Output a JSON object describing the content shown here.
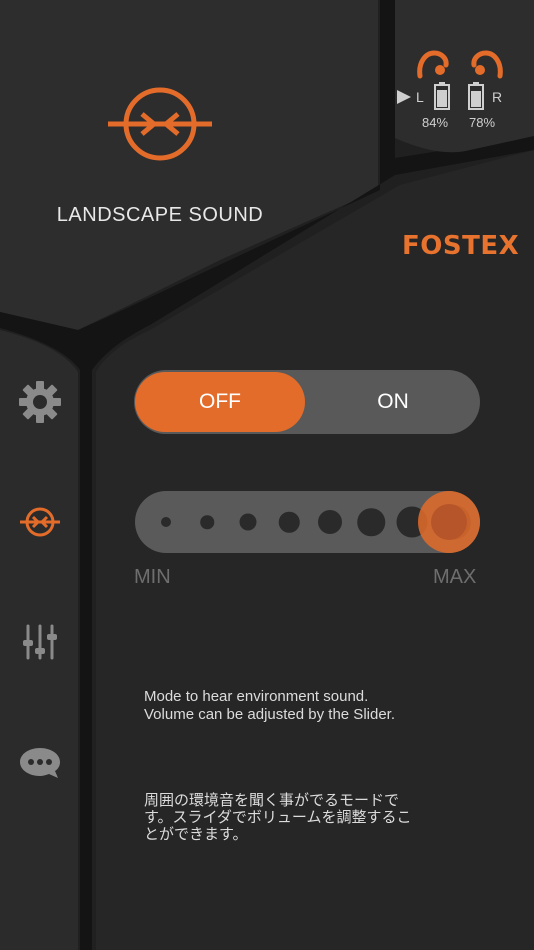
{
  "header": {
    "mode_title": "LANDSCAPE SOUND",
    "brand": "FOSTEX"
  },
  "battery": {
    "left": {
      "label": "L",
      "percent": "84%",
      "level": 0.84,
      "indicator": "play-arrow-icon"
    },
    "right": {
      "label": "R",
      "percent": "78%",
      "level": 0.78
    }
  },
  "sidebar": {
    "items": [
      {
        "name": "settings",
        "icon": "gear-icon",
        "active": false
      },
      {
        "name": "landscape-sound",
        "icon": "landscape-sound-icon",
        "active": true
      },
      {
        "name": "equalizer",
        "icon": "sliders-icon",
        "active": false
      },
      {
        "name": "chat",
        "icon": "chat-bubble-icon",
        "active": false
      }
    ]
  },
  "toggle": {
    "off_label": "OFF",
    "on_label": "ON",
    "selected": "OFF"
  },
  "volume": {
    "min_label": "MIN",
    "max_label": "MAX",
    "level": 1.0,
    "steps": 8
  },
  "description": {
    "en_line1": "Mode to hear environment sound.",
    "en_line2": "Volume can be adjusted by the Slider.",
    "jp_line1": "周囲の環境音を聞く事がでるモードで",
    "jp_line2": "す。スライダでボリュームを調整するこ",
    "jp_line3": "とができます。"
  },
  "colors": {
    "accent": "#e36c2a",
    "background": "#222222",
    "panel": "#2c2c2c",
    "control_track": "#595959"
  }
}
